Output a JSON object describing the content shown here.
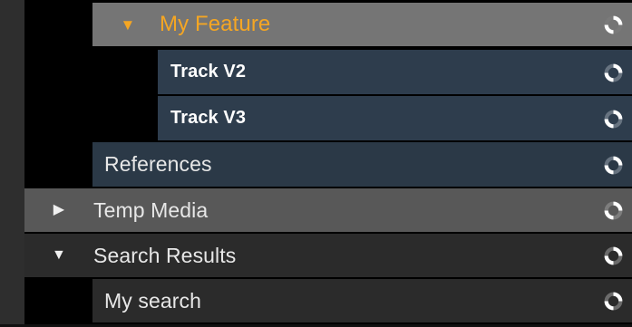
{
  "tree": {
    "rows": [
      {
        "label": "My Feature",
        "state": "expanded",
        "icon": "loading-spinner-icon",
        "color": "#f5a623"
      },
      {
        "label": "Track V2",
        "icon": "loading-spinner-icon"
      },
      {
        "label": "Track V3",
        "icon": "loading-spinner-icon"
      },
      {
        "label": "References",
        "icon": "loading-spinner-icon"
      },
      {
        "label": "Temp Media",
        "state": "collapsed",
        "icon": "loading-spinner-icon"
      },
      {
        "label": "Search Results",
        "state": "expanded",
        "icon": "loading-spinner-icon"
      },
      {
        "label": "My search",
        "icon": "loading-spinner-icon"
      }
    ]
  },
  "theme": {
    "selected_bg": "#757575",
    "accent": "#f5a623",
    "track_bg": "#2e3d4d",
    "folder_bg": "#585858"
  }
}
